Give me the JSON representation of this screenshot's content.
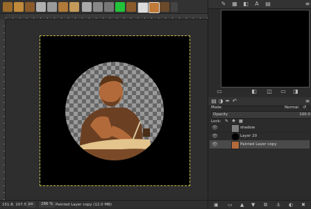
{
  "status": {
    "coords": "151.8, 107.5",
    "unit": "px",
    "zoom": "286 %",
    "info": "Painted Layer copy (12.0 MB)"
  },
  "layers_panel": {
    "mode_label": "Mode",
    "mode_value": "Normal",
    "opacity_label": "Opacity",
    "opacity_value": "100.0",
    "lock_label": "Lock:",
    "layers": [
      {
        "name": "shadow"
      },
      {
        "name": "Layer 20"
      },
      {
        "name": "Painted Layer copy"
      }
    ]
  },
  "colors": {
    "background": "#2b2b2b",
    "selected_layer": "#4a4a4a",
    "image_bg": "#000000",
    "skin": "#b26a3a",
    "apron": "#6b3f22"
  }
}
